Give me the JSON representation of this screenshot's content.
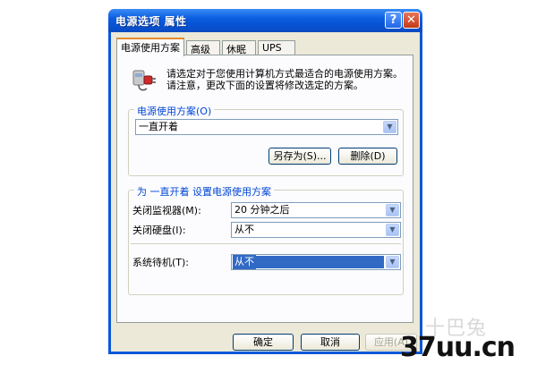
{
  "window": {
    "title": "电源选项 属性"
  },
  "titlebar_buttons": {
    "help": "?",
    "close": "✕"
  },
  "tabs": [
    {
      "label": "电源使用方案",
      "active": true
    },
    {
      "label": "高级",
      "active": false
    },
    {
      "label": "休眠",
      "active": false
    },
    {
      "label": "UPS",
      "active": false
    }
  ],
  "description": "请选定对于您使用计算机方式最适合的电源使用方案。请注意，更改下面的设置将修改选定的方案。",
  "scheme_group": {
    "label": "电源使用方案(O)",
    "selected": "一直开着",
    "save_as": "另存为(S)...",
    "delete": "删除(D)"
  },
  "settings_group": {
    "label": "为 一直开着 设置电源使用方案",
    "rows": [
      {
        "label": "关闭监视器(M):",
        "value": "20 分钟之后"
      },
      {
        "label": "关闭硬盘(I):",
        "value": "从不"
      },
      {
        "label": "系统待机(T):",
        "value": "从不"
      }
    ]
  },
  "footer": {
    "ok": "确定",
    "cancel": "取消",
    "apply": "应用(A)"
  },
  "watermark": {
    "logo": "十巴兔",
    "site": "37uu.cn"
  },
  "colors": {
    "title_bar": "#0852d4",
    "group_label": "#0046d5",
    "selection": "#316ac5",
    "dialog_face": "#ece9d8"
  }
}
